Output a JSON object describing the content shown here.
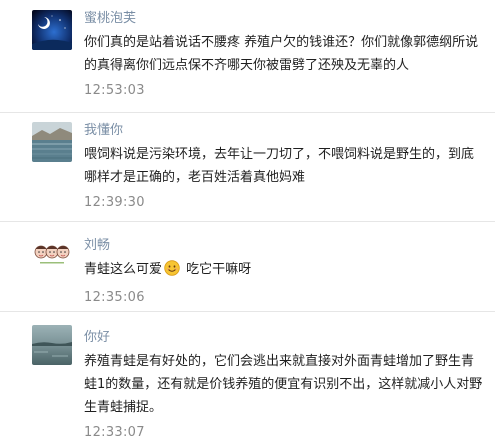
{
  "comments": [
    {
      "username": "蜜桃泡芙",
      "avatar_icon": "night-sky-avatar",
      "text": "你们真的是站着说话不腰疼 养殖户欠的钱谁还？你们就像郭德纲所说的真得离你们远点保不齐哪天你被雷劈了还殃及无辜的人",
      "time": "12:53:03"
    },
    {
      "username": "我懂你",
      "avatar_icon": "landscape-avatar",
      "text": "喂饲料说是污染环境，去年让一刀切了，不喂饲料说是野生的，到底哪样才是正确的，老百姓活着真他妈难",
      "time": "12:39:30"
    },
    {
      "username": "刘畅",
      "avatar_icon": "cartoon-faces-avatar",
      "text_before_emoji": "青蛙这么可爱",
      "emoji": "smiling-face-emoji",
      "text_after_emoji": " 吃它干嘛呀",
      "time": "12:35:06"
    },
    {
      "username": "你好",
      "avatar_icon": "lake-avatar",
      "text": "养殖青蛙是有好处的，它们会逃出来就直接对外面青蛙增加了野生青蛙1的数量，还有就是价钱养殖的便宜有识别不出，这样就减小人对野生青蛙捕捉。",
      "time": "12:33:07"
    }
  ],
  "colors": {
    "username": "#7b8fa6",
    "time": "#8a8a8a",
    "text": "#1f1f1f",
    "divider": "#e6e6e6"
  }
}
